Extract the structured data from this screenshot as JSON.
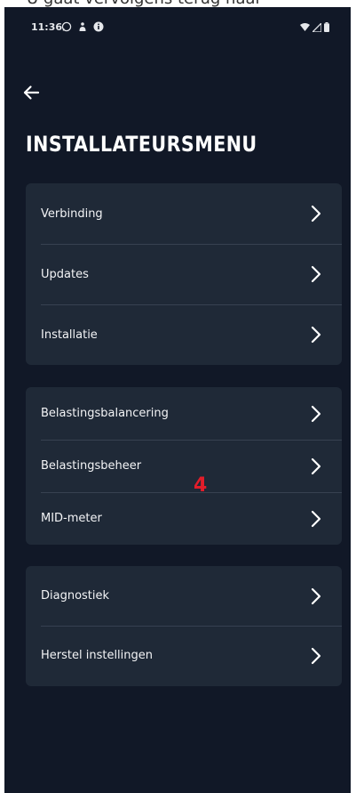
{
  "caption": "U gaat vervolgens terug naar",
  "status_bar": {
    "time": "11:36",
    "left_icons": [
      "whatsapp-icon",
      "person-notification-icon",
      "info-icon"
    ],
    "right_icons": [
      "wifi-icon",
      "signal-icon",
      "battery-icon"
    ]
  },
  "header": {
    "back_icon": "arrow-left-icon",
    "title": "INSTALLATEURSMENU"
  },
  "groups": [
    {
      "items": [
        {
          "label": "Verbinding"
        },
        {
          "label": "Updates"
        },
        {
          "label": "Installatie"
        }
      ]
    },
    {
      "items": [
        {
          "label": "Belastingsbalancering"
        },
        {
          "label": "Belastingsbeheer"
        },
        {
          "label": "MID-meter"
        }
      ]
    },
    {
      "items": [
        {
          "label": "Diagnostiek"
        },
        {
          "label": "Herstel instellingen"
        }
      ]
    }
  ],
  "annotation": "4",
  "colors": {
    "background": "#111827",
    "card": "#1f2937",
    "divider": "#374151",
    "text": "#ffffff",
    "annotation": "#e11d2a"
  }
}
